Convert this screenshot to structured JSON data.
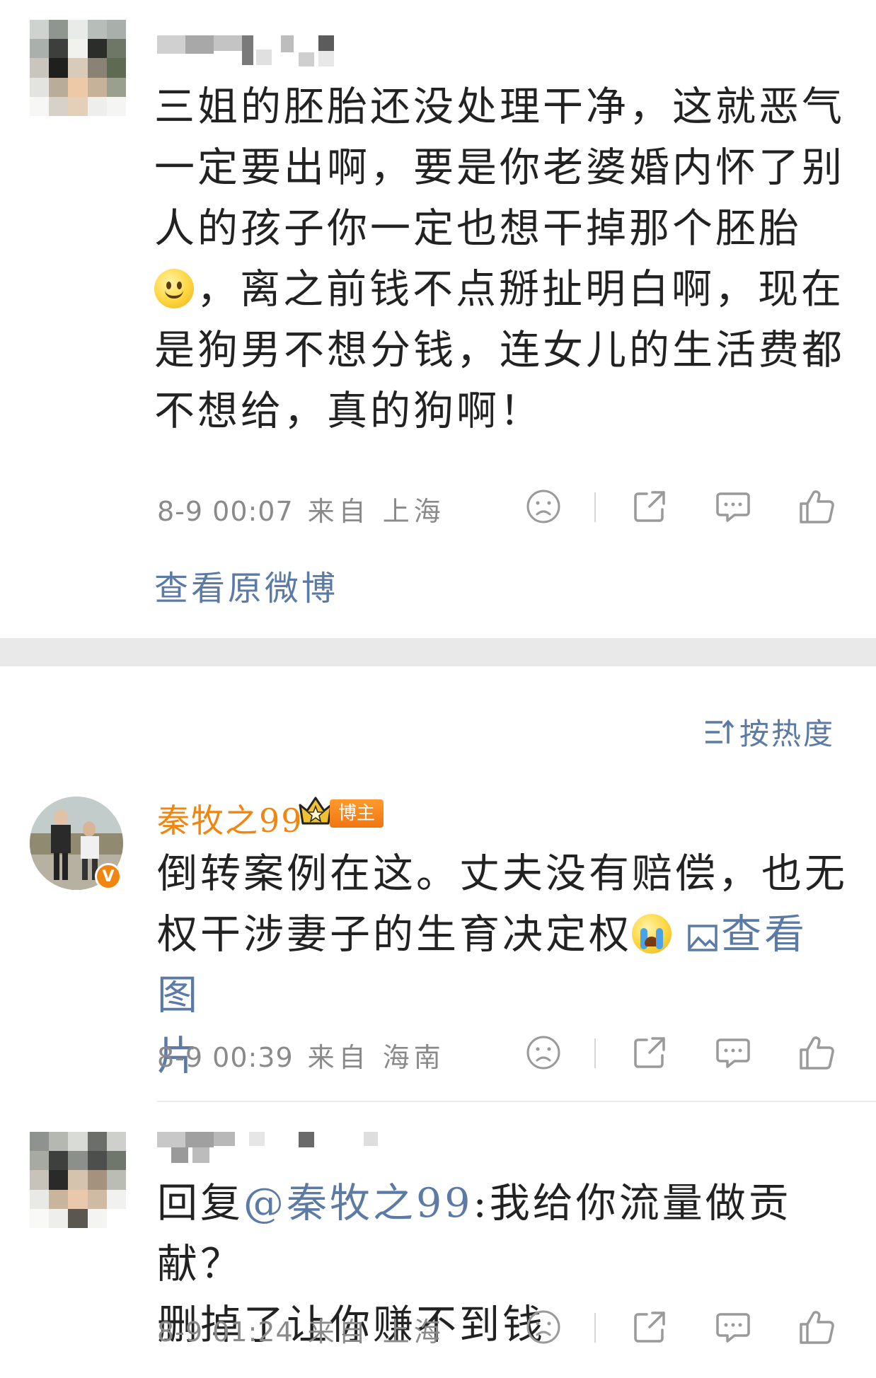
{
  "comment1": {
    "lines": [
      "三姐的胚胎还没处理干净，这就恶气",
      "一定要出啊，要是你老婆婚内怀了别",
      "人的孩子你一定也想干掉那个胚胎",
      "，离之前钱不点掰扯明白啊，现在",
      "是狗男不想分钱，连女儿的生活费都",
      "不想给，真的狗啊！"
    ],
    "date": "8-9 00:07",
    "from": "来自 上海",
    "emoji": "smile"
  },
  "view_original": "查看原微博",
  "sort_label": "按热度",
  "comment2": {
    "username": "秦牧之99",
    "badge": "博主",
    "lines": [
      "倒转案例在这。丈夫没有赔偿，也无",
      "权干涉妻子的生育决定权",
      "片"
    ],
    "pic_link": "查看图",
    "date": "8-9 00:39",
    "from": "来自 海南",
    "emoji": "cry"
  },
  "comment3": {
    "reply_prefix": "回复",
    "mention": "@秦牧之99",
    "reply_text": ":我给你流量做贡献？",
    "line2": "删掉了让你赚不到钱",
    "date": "8-9 01:24",
    "from": "来自 上海"
  },
  "colors": {
    "accent_blue": "#5b7aa6",
    "username_orange": "#f0850f",
    "meta_gray": "#8a8a8a"
  },
  "icons": [
    "dislike-face-icon",
    "share-icon",
    "comment-icon",
    "like-thumb-icon"
  ]
}
